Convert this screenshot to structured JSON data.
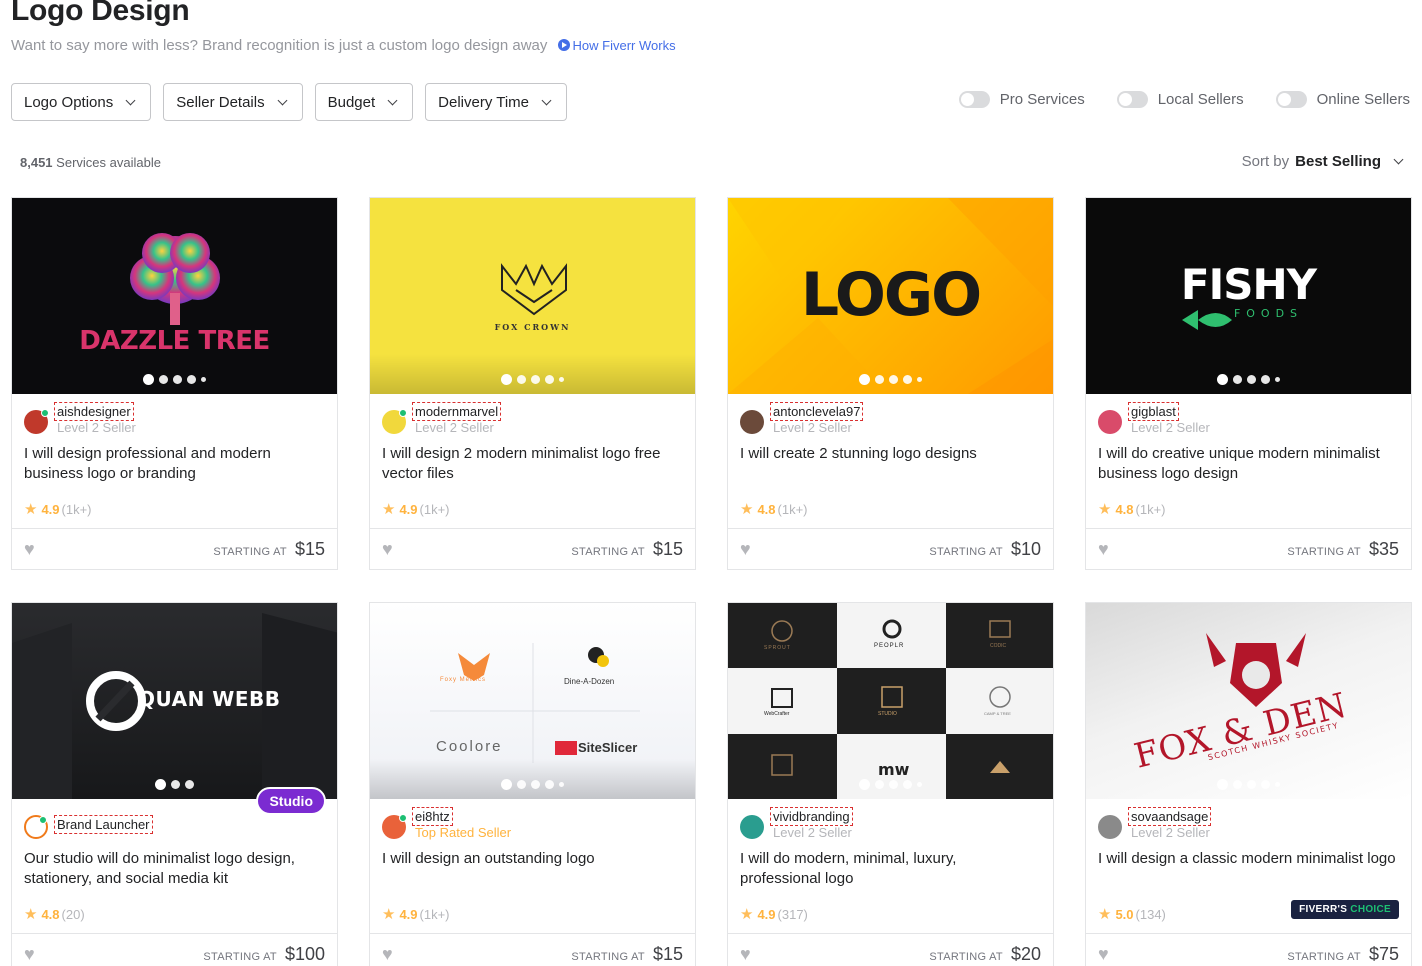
{
  "page": {
    "title": "Logo Design",
    "subtitle": "Want to say more with less? Brand recognition is just a custom logo design away",
    "how_link": "How Fiverr Works"
  },
  "filters": [
    "Logo Options",
    "Seller Details",
    "Budget",
    "Delivery Time"
  ],
  "toggles": [
    "Pro Services",
    "Local Sellers",
    "Online Sellers"
  ],
  "results": {
    "count": "8,451",
    "count_suffix": "Services available",
    "sort_label": "Sort by",
    "sort_value": "Best Selling"
  },
  "colors": {
    "accent_green": "#1dbf73",
    "star_yellow": "#ffbe5b",
    "studio_purple": "#7b2bd1",
    "link_blue": "#446ee7"
  },
  "gigs": [
    {
      "seller": "aishdesigner",
      "level": "Level 2 Seller",
      "title": "I will design professional and modern business logo or branding",
      "rating": "4.9",
      "reviews": "(1k+)",
      "starting": "STARTING AT",
      "price": "$15",
      "image_text": "DAZZLE TREE",
      "icon": "heart-icon"
    },
    {
      "seller": "modernmarvel",
      "level": "Level 2 Seller",
      "title": "I will design 2 modern minimalist logo free vector files",
      "rating": "4.9",
      "reviews": "(1k+)",
      "starting": "STARTING AT",
      "price": "$15",
      "image_text": "FOX CROWN",
      "icon": "heart-icon"
    },
    {
      "seller": "antonclevela97",
      "level": "Level 2 Seller",
      "title": "I will create 2 stunning logo designs",
      "rating": "4.8",
      "reviews": "(1k+)",
      "starting": "STARTING AT",
      "price": "$10",
      "image_text": "LOGO",
      "icon": "heart-icon"
    },
    {
      "seller": "gigblast",
      "level": "Level 2 Seller",
      "title": "I will do creative unique modern minimalist business logo design",
      "rating": "4.8",
      "reviews": "(1k+)",
      "starting": "STARTING AT",
      "price": "$35",
      "image_text": "FISHY",
      "image_subtext": "FOODS",
      "icon": "heart-icon"
    },
    {
      "seller": "Brand Launcher",
      "level": "",
      "badge": "Studio",
      "title": "Our studio will do minimalist logo design, stationery, and social media kit",
      "rating": "4.8",
      "reviews": "(20)",
      "starting": "STARTING AT",
      "price": "$100",
      "image_text": "QUAN WEBB",
      "icon": "heart-icon"
    },
    {
      "seller": "ei8htz",
      "level": "Top Rated Seller",
      "title": "I will design an outstanding logo",
      "rating": "4.9",
      "reviews": "(1k+)",
      "starting": "STARTING AT",
      "price": "$15",
      "image_labels": [
        "Foxy Metrics",
        "Dine-A-Dozen",
        "Coolore",
        "SiteSlicer"
      ],
      "icon": "heart-icon"
    },
    {
      "seller": "vividbranding",
      "level": "Level 2 Seller",
      "title": "I will do modern, minimal, luxury, professional logo",
      "rating": "4.9",
      "reviews": "(317)",
      "starting": "STARTING AT",
      "price": "$20",
      "image_labels": [
        "SPROUT",
        "PEOPLR",
        "CODIC",
        "WebCrafter",
        "STUDIO",
        "CAMP & TREE"
      ],
      "icon": "heart-icon"
    },
    {
      "seller": "sovaandsage",
      "level": "Level 2 Seller",
      "choice_a": "FIVERR'S",
      "choice_b": "CHOICE",
      "title": "I will design a classic modern minimalist logo",
      "rating": "5.0",
      "reviews": "(134)",
      "starting": "STARTING AT",
      "price": "$75",
      "image_text": "FOX & DEN",
      "image_subtext": "SCOTCH WHISKY SOCIETY",
      "icon": "heart-icon"
    }
  ]
}
